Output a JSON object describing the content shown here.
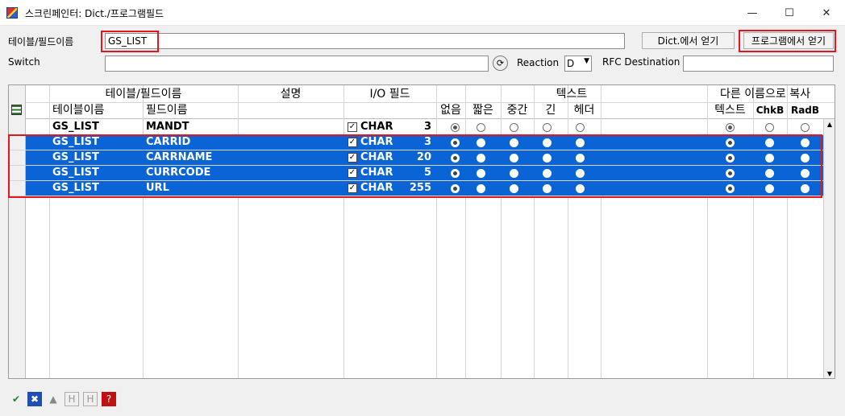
{
  "window": {
    "title": "스크린페인터: Dict./프로그램필드",
    "minimize": "—",
    "maximize": "☐",
    "close": "✕"
  },
  "form": {
    "table_field_label": "테이블/필드이름",
    "table_field_value": "GS_LIST",
    "switch_label": "Switch",
    "switch_value": "",
    "reaction_label": "Reaction",
    "reaction_value": "D",
    "rfc_label": "RFC Destination",
    "rfc_value": "",
    "dict_button": "Dict.에서 얻기",
    "program_button": "프로그램에서 얻기"
  },
  "grid": {
    "headers_top": {
      "table_field": "테이블/필드이름",
      "desc": "설명",
      "io": "I/O 필드",
      "text": "텍스트",
      "copy": "다른 이름으로 복사"
    },
    "headers_sub": {
      "table": "테이블이름",
      "field": "필드이름",
      "none": "없음",
      "short": "짧은",
      "medium": "중간",
      "long": "긴",
      "header": "헤더",
      "copy_text": "텍스트",
      "chkb": "ChkB",
      "radb": "RadB"
    },
    "rows": [
      {
        "table": "GS_LIST",
        "field": "MANDT",
        "type": "CHAR",
        "len": "3",
        "text_sel": 0,
        "copy_sel": 0,
        "selected": false
      },
      {
        "table": "GS_LIST",
        "field": "CARRID",
        "type": "CHAR",
        "len": "3",
        "text_sel": 0,
        "copy_sel": 0,
        "selected": true
      },
      {
        "table": "GS_LIST",
        "field": "CARRNAME",
        "type": "CHAR",
        "len": "20",
        "text_sel": 0,
        "copy_sel": 0,
        "selected": true
      },
      {
        "table": "GS_LIST",
        "field": "CURRCODE",
        "type": "CHAR",
        "len": "5",
        "text_sel": 0,
        "copy_sel": 0,
        "selected": true
      },
      {
        "table": "GS_LIST",
        "field": "URL",
        "type": "CHAR",
        "len": "255",
        "text_sel": 0,
        "copy_sel": 0,
        "selected": true
      }
    ]
  },
  "toolbar": {
    "icons": [
      "check-icon",
      "cancel-icon",
      "transfer-icon",
      "save-icon",
      "save-as-icon",
      "help-icon"
    ],
    "glyphs": [
      "✔",
      "✖",
      "▲",
      "H",
      "H",
      "?"
    ]
  },
  "colors": {
    "selection": "#0a64d6",
    "highlight": "#e5151d"
  }
}
